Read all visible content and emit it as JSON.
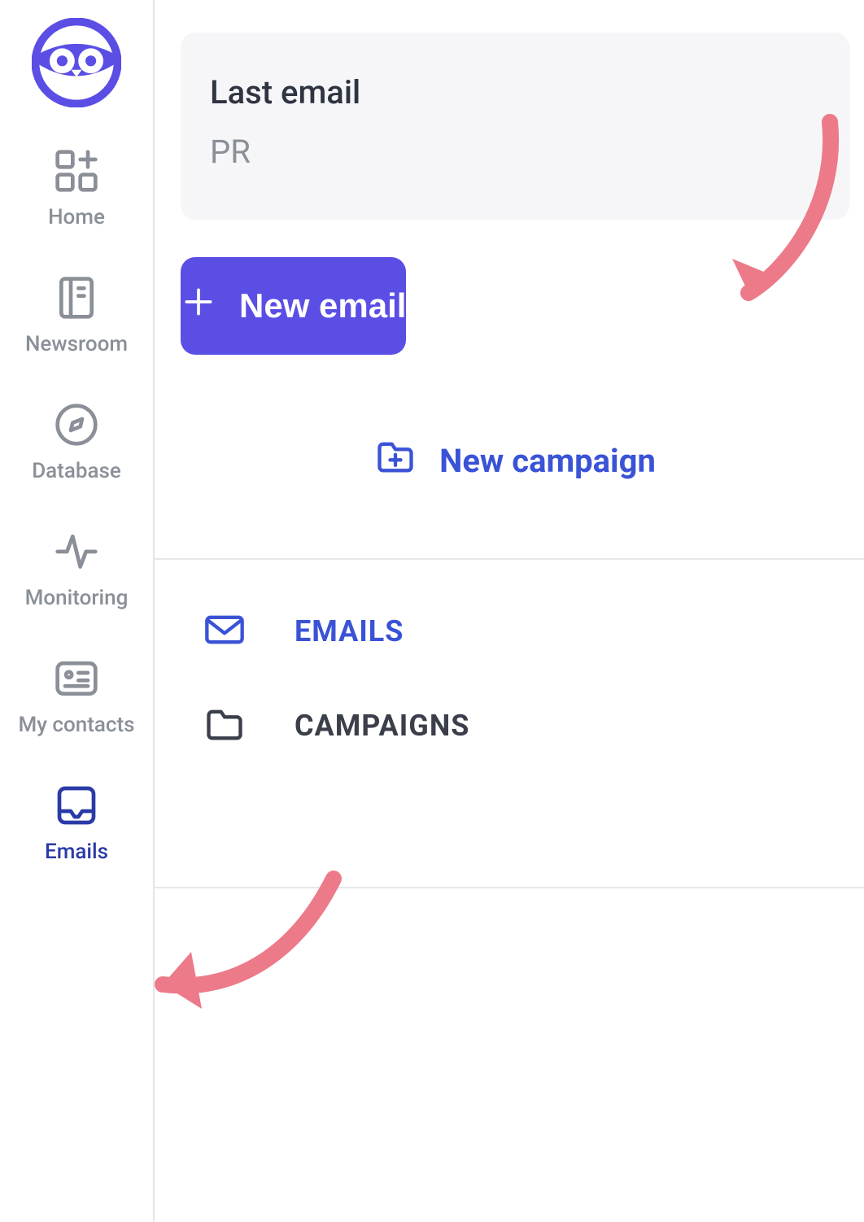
{
  "sidebar": {
    "items": [
      {
        "label": "Home"
      },
      {
        "label": "Newsroom"
      },
      {
        "label": "Database"
      },
      {
        "label": "Monitoring"
      },
      {
        "label": "My contacts"
      },
      {
        "label": "Emails"
      }
    ]
  },
  "main": {
    "card": {
      "title": "Last email",
      "subtitle": "PR"
    },
    "new_email_label": "New email",
    "new_campaign_label": "New campaign",
    "tabs": [
      {
        "label": "EMAILS"
      },
      {
        "label": "CAMPAIGNS"
      }
    ]
  },
  "colors": {
    "primary": "#5b4ee5",
    "link": "#3a53d6",
    "muted": "#8a8f98",
    "annotation": "#ec7a89"
  }
}
